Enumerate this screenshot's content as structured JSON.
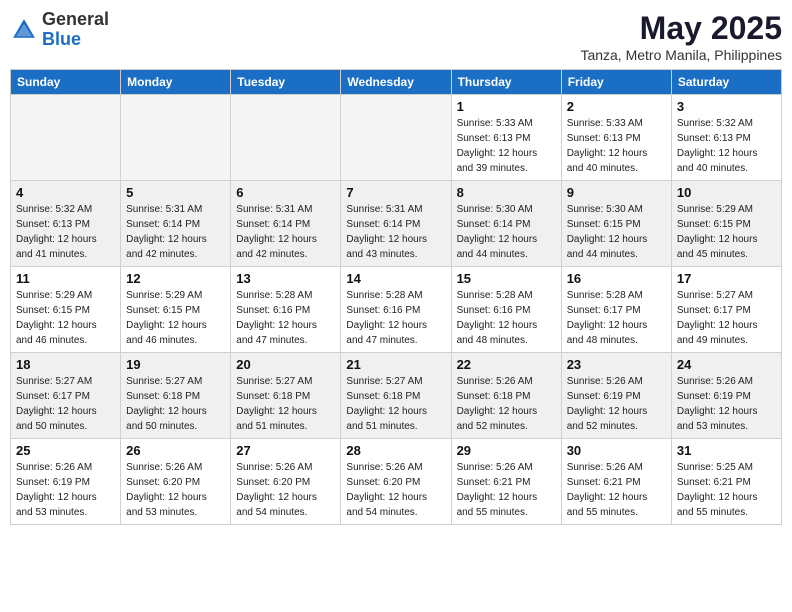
{
  "header": {
    "logo_general": "General",
    "logo_blue": "Blue",
    "month_title": "May 2025",
    "location": "Tanza, Metro Manila, Philippines"
  },
  "weekdays": [
    "Sunday",
    "Monday",
    "Tuesday",
    "Wednesday",
    "Thursday",
    "Friday",
    "Saturday"
  ],
  "weeks": [
    [
      {
        "day": "",
        "empty": true
      },
      {
        "day": "",
        "empty": true
      },
      {
        "day": "",
        "empty": true
      },
      {
        "day": "",
        "empty": true
      },
      {
        "day": "1",
        "sunrise": "5:33 AM",
        "sunset": "6:13 PM",
        "daylight": "12 hours and 39 minutes."
      },
      {
        "day": "2",
        "sunrise": "5:33 AM",
        "sunset": "6:13 PM",
        "daylight": "12 hours and 40 minutes."
      },
      {
        "day": "3",
        "sunrise": "5:32 AM",
        "sunset": "6:13 PM",
        "daylight": "12 hours and 40 minutes."
      }
    ],
    [
      {
        "day": "4",
        "sunrise": "5:32 AM",
        "sunset": "6:13 PM",
        "daylight": "12 hours and 41 minutes."
      },
      {
        "day": "5",
        "sunrise": "5:31 AM",
        "sunset": "6:14 PM",
        "daylight": "12 hours and 42 minutes."
      },
      {
        "day": "6",
        "sunrise": "5:31 AM",
        "sunset": "6:14 PM",
        "daylight": "12 hours and 42 minutes."
      },
      {
        "day": "7",
        "sunrise": "5:31 AM",
        "sunset": "6:14 PM",
        "daylight": "12 hours and 43 minutes."
      },
      {
        "day": "8",
        "sunrise": "5:30 AM",
        "sunset": "6:14 PM",
        "daylight": "12 hours and 44 minutes."
      },
      {
        "day": "9",
        "sunrise": "5:30 AM",
        "sunset": "6:15 PM",
        "daylight": "12 hours and 44 minutes."
      },
      {
        "day": "10",
        "sunrise": "5:29 AM",
        "sunset": "6:15 PM",
        "daylight": "12 hours and 45 minutes."
      }
    ],
    [
      {
        "day": "11",
        "sunrise": "5:29 AM",
        "sunset": "6:15 PM",
        "daylight": "12 hours and 46 minutes."
      },
      {
        "day": "12",
        "sunrise": "5:29 AM",
        "sunset": "6:15 PM",
        "daylight": "12 hours and 46 minutes."
      },
      {
        "day": "13",
        "sunrise": "5:28 AM",
        "sunset": "6:16 PM",
        "daylight": "12 hours and 47 minutes."
      },
      {
        "day": "14",
        "sunrise": "5:28 AM",
        "sunset": "6:16 PM",
        "daylight": "12 hours and 47 minutes."
      },
      {
        "day": "15",
        "sunrise": "5:28 AM",
        "sunset": "6:16 PM",
        "daylight": "12 hours and 48 minutes."
      },
      {
        "day": "16",
        "sunrise": "5:28 AM",
        "sunset": "6:17 PM",
        "daylight": "12 hours and 48 minutes."
      },
      {
        "day": "17",
        "sunrise": "5:27 AM",
        "sunset": "6:17 PM",
        "daylight": "12 hours and 49 minutes."
      }
    ],
    [
      {
        "day": "18",
        "sunrise": "5:27 AM",
        "sunset": "6:17 PM",
        "daylight": "12 hours and 50 minutes."
      },
      {
        "day": "19",
        "sunrise": "5:27 AM",
        "sunset": "6:18 PM",
        "daylight": "12 hours and 50 minutes."
      },
      {
        "day": "20",
        "sunrise": "5:27 AM",
        "sunset": "6:18 PM",
        "daylight": "12 hours and 51 minutes."
      },
      {
        "day": "21",
        "sunrise": "5:27 AM",
        "sunset": "6:18 PM",
        "daylight": "12 hours and 51 minutes."
      },
      {
        "day": "22",
        "sunrise": "5:26 AM",
        "sunset": "6:18 PM",
        "daylight": "12 hours and 52 minutes."
      },
      {
        "day": "23",
        "sunrise": "5:26 AM",
        "sunset": "6:19 PM",
        "daylight": "12 hours and 52 minutes."
      },
      {
        "day": "24",
        "sunrise": "5:26 AM",
        "sunset": "6:19 PM",
        "daylight": "12 hours and 53 minutes."
      }
    ],
    [
      {
        "day": "25",
        "sunrise": "5:26 AM",
        "sunset": "6:19 PM",
        "daylight": "12 hours and 53 minutes."
      },
      {
        "day": "26",
        "sunrise": "5:26 AM",
        "sunset": "6:20 PM",
        "daylight": "12 hours and 53 minutes."
      },
      {
        "day": "27",
        "sunrise": "5:26 AM",
        "sunset": "6:20 PM",
        "daylight": "12 hours and 54 minutes."
      },
      {
        "day": "28",
        "sunrise": "5:26 AM",
        "sunset": "6:20 PM",
        "daylight": "12 hours and 54 minutes."
      },
      {
        "day": "29",
        "sunrise": "5:26 AM",
        "sunset": "6:21 PM",
        "daylight": "12 hours and 55 minutes."
      },
      {
        "day": "30",
        "sunrise": "5:26 AM",
        "sunset": "6:21 PM",
        "daylight": "12 hours and 55 minutes."
      },
      {
        "day": "31",
        "sunrise": "5:25 AM",
        "sunset": "6:21 PM",
        "daylight": "12 hours and 55 minutes."
      }
    ]
  ],
  "labels": {
    "sunrise": "Sunrise:",
    "sunset": "Sunset:",
    "daylight": "Daylight:"
  }
}
